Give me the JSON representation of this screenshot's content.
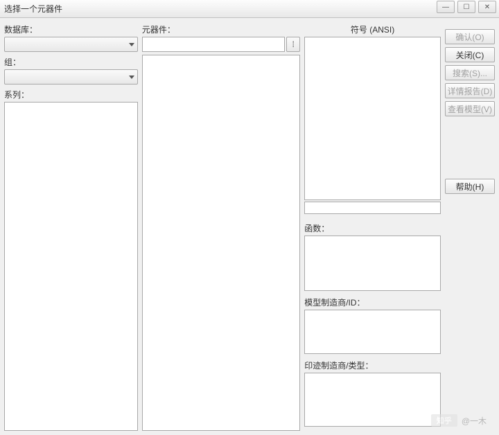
{
  "window": {
    "title": "选择一个元器件"
  },
  "left": {
    "database_label": "数据库：",
    "group_label": "组：",
    "series_label": "系列："
  },
  "mid": {
    "component_label": "元器件："
  },
  "right": {
    "symbol_label": "符号 (ANSI)",
    "function_label": "函数：",
    "model_maker_label": "模型制造商/ID：",
    "footprint_label": "印迹制造商/类型："
  },
  "buttons": {
    "ok": "确认(O)",
    "close": "关闭(C)",
    "search": "搜索(S)...",
    "detail_report": "详情报告(D)",
    "view_model": "查看模型(V)",
    "help": "帮助(H)"
  },
  "watermark": {
    "brand": "知乎",
    "user": "@一木"
  }
}
